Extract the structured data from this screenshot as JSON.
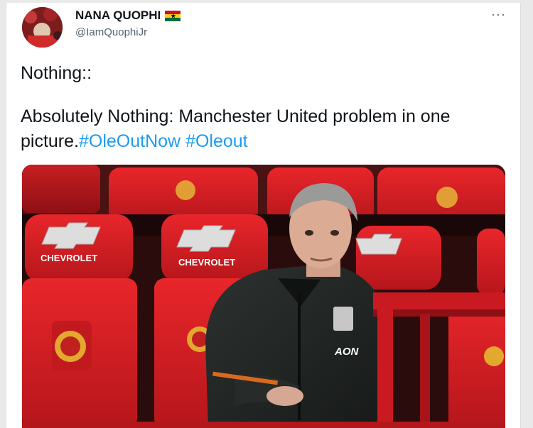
{
  "tweet": {
    "author_name": "NANA QUOPHI",
    "flag_icon": "ghana-flag-icon",
    "handle": "@IamQuophiJr",
    "more_label": "···",
    "line1": "Nothing::",
    "line2": "Absolutely Nothing: Manchester United problem in one picture.",
    "hashtag1": "#OleOutNow",
    "hashtag2": "#Oleout",
    "media": {
      "seat_sponsor": "CHEVROLET",
      "shirt_sponsor": "AON"
    }
  },
  "colors": {
    "link": "#1d9bf0",
    "seat_red": "#d41d23",
    "text": "#0f1419",
    "muted": "#536471"
  }
}
